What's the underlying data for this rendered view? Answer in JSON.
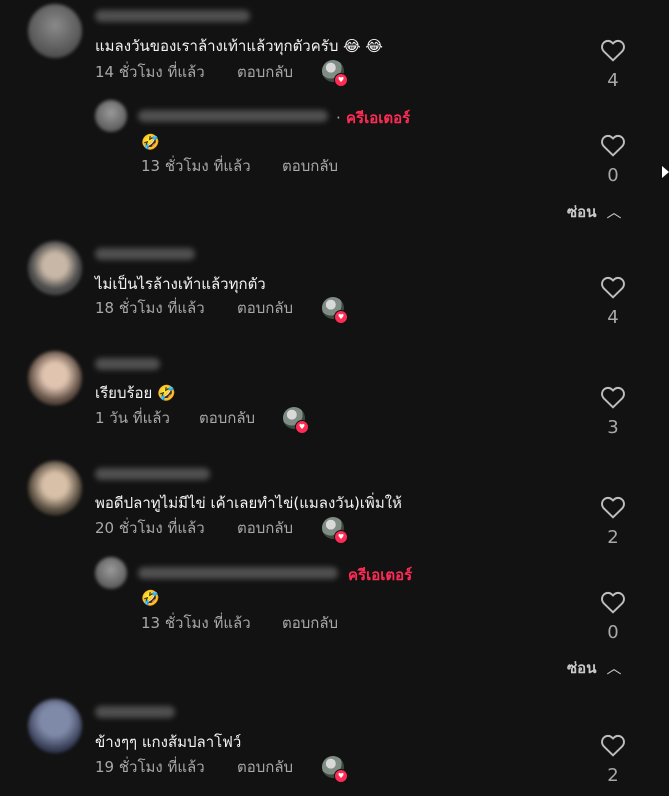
{
  "comments": [
    {
      "text": "แมลงวันของเราล้างเท้าแล้วทุกตัวครับ 😂 😂",
      "time": "14 ชั่วโมง ที่แล้ว",
      "reply": "ตอบกลับ",
      "likes": "4",
      "reply_item": {
        "badge": "ครีเอเตอร์",
        "text": "🤣",
        "time": "13 ชั่วโมง ที่แล้ว",
        "reply": "ตอบกลับ",
        "likes": "0",
        "hide": "ซ่อน"
      }
    },
    {
      "text": "ไม่เป็นไรล้างเท้าแล้วทุกตัว",
      "time": "18 ชั่วโมง ที่แล้ว",
      "reply": "ตอบกลับ",
      "likes": "4"
    },
    {
      "text": "เรียบร้อย 🤣",
      "time": "1 วัน ที่แล้ว",
      "reply": "ตอบกลับ",
      "likes": "3"
    },
    {
      "text": "พอดีปลาทูไม่มีไข่ เค้าเลยทำไข่(แมลงวัน)เพิ่มให้",
      "time": "20 ชั่วโมง ที่แล้ว",
      "reply": "ตอบกลับ",
      "likes": "2",
      "reply_item": {
        "badge": "ครีเอเตอร์",
        "text": "🤣",
        "time": "13 ชั่วโมง ที่แล้ว",
        "reply": "ตอบกลับ",
        "likes": "0",
        "hide": "ซ่อน"
      }
    },
    {
      "text": "ข้างๆๆ แกงส้มปลาโฟว์",
      "time": "19 ชั่วโมง ที่แล้ว",
      "reply": "ตอบกลับ",
      "likes": "2"
    }
  ],
  "icons": {
    "like": "heart-outline-icon",
    "creator_liked": "creator-liked-avatar-icon",
    "collapse": "chevron-up-icon"
  },
  "colors": {
    "background": "#121212",
    "creator_badge": "#fe2c55",
    "muted_text": "#a8a8a8"
  }
}
